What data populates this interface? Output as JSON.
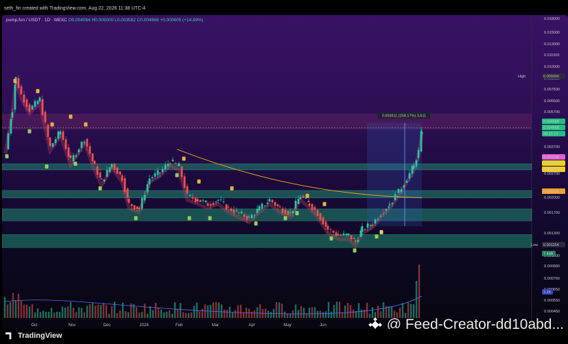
{
  "header": {
    "credit": "seth_fin created with TradingView.com, Aug 22, 2026 11:38 UTC-4"
  },
  "legend": {
    "symbol": "pump.fun / USDT · 1D · MEXC",
    "ohlc": "O0.004064 H0.005000 L0.003582 C0.004668 +0.000605 (+14.89%)"
  },
  "price_axis": {
    "ticks": [
      "0.018000",
      "0.015000",
      "0.013000",
      "0.011500",
      "0.010000",
      "0.008500",
      "0.007500",
      "0.006500",
      "0.005700",
      "0.003700",
      "0.002700",
      "0.002000",
      "0.001700",
      "0.001300",
      "0.001000",
      "0.000880",
      "0.000760",
      "0.000650",
      "0.000550",
      "0.000450"
    ],
    "high_label": "High",
    "high_value": "0.009000",
    "low_label": "Low",
    "low_value": "0.001154",
    "current_price": "0.004668",
    "current_price_2": "0.004668",
    "countdown": "08:21:10",
    "level_pink": "0.003138",
    "level_yellow_1": "0.003294",
    "level_yellow_2": "0.003014",
    "level_orange": "0.002115",
    "volume_value": "7.49B",
    "volume_ma_value": "3.28"
  },
  "measure_tooltip": "0.003611 (258.17%) 3,611",
  "time_axis": [
    "Oct",
    "Nov",
    "Dec",
    "2026",
    "Feb",
    "Mar",
    "Apr",
    "May",
    "Jun"
  ],
  "footer": {
    "brand": "TradingView",
    "watermark": "@ Feed-Creator-dd10abd..."
  },
  "colors": {
    "up": "#26c6a0",
    "down": "#ef5350",
    "zone": "#1f8a6e",
    "ma": "#f0a020",
    "bg_top": "#3a1166"
  },
  "chart_data": {
    "type": "candlestick",
    "symbol": "pump.fun / USDT",
    "interval": "1D",
    "y_scale": "log",
    "last": {
      "open": 0.004064,
      "high": 0.005,
      "low": 0.003582,
      "close": 0.004668,
      "change": 0.000605,
      "change_pct": 14.89
    },
    "high": 0.009,
    "low": 0.001154,
    "support_resistance_zones": [
      [
        0.00288,
        0.0031
      ],
      [
        0.00205,
        0.00224
      ],
      [
        0.00155,
        0.00179
      ],
      [
        0.00112,
        0.00131
      ]
    ],
    "measure": {
      "change": 0.003611,
      "change_pct": 258.17
    }
  }
}
